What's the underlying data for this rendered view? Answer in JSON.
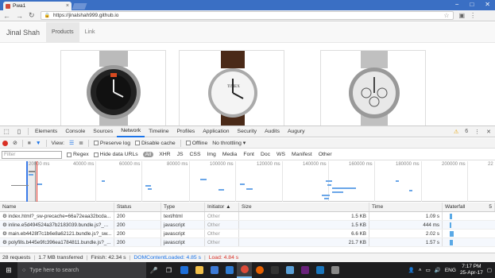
{
  "browser": {
    "tab_title": "Pwa1",
    "url": "https://jinalshah999.github.io",
    "win_buttons": [
      "−",
      "□",
      "✕"
    ]
  },
  "page": {
    "brand": "Jinal Shah",
    "nav": [
      "Products",
      "Link"
    ]
  },
  "devtools": {
    "tabs": [
      "Elements",
      "Console",
      "Sources",
      "Network",
      "Timeline",
      "Profiles",
      "Application",
      "Security",
      "Audits",
      "Augury"
    ],
    "active_tab": "Network",
    "warning_count": "6",
    "toolbar": {
      "view_label": "View:",
      "preserve_log": "Preserve log",
      "disable_cache": "Disable cache",
      "offline": "Offline",
      "throttle": "No throttling"
    },
    "filter": {
      "placeholder": "Filter",
      "regex": "Regex",
      "hide_data_urls": "Hide data URLs",
      "types": [
        "All",
        "XHR",
        "JS",
        "CSS",
        "Img",
        "Media",
        "Font",
        "Doc",
        "WS",
        "Manifest",
        "Other"
      ]
    },
    "overview_ticks": [
      "20000 ms",
      "40000 ms",
      "60000 ms",
      "80000 ms",
      "100000 ms",
      "120000 ms",
      "140000 ms",
      "160000 ms",
      "180000 ms",
      "200000 ms",
      "22"
    ],
    "columns": {
      "name": "Name",
      "status": "Status",
      "type": "Type",
      "initiator": "Initiator",
      "size": "Size",
      "time": "Time",
      "waterfall": "Waterfall",
      "waterfall_extra": "5"
    },
    "rows": [
      {
        "name": "index.html?_sw-precache=66a72eaa32bcda...",
        "status": "200",
        "type": "text/html",
        "initiator": "Other",
        "size": "1.5 KB",
        "time": "1.09 s",
        "wf": 0.55
      },
      {
        "name": "inline.e5d494524a37b2183039.bundle.js?_...",
        "status": "200",
        "type": "javascript",
        "initiator": "Other",
        "size": "1.5 KB",
        "time": "444 ms",
        "wf": 0.22
      },
      {
        "name": "main.eb4428f7c1b6e8a62121.bundle.js?_sw...",
        "status": "200",
        "type": "javascript",
        "initiator": "Other",
        "size": "6.6 KB",
        "time": "2.02 s",
        "wf": 1.0
      },
      {
        "name": "polyfills.b445e9fc396ea1784811.bundle.js?_...",
        "status": "200",
        "type": "javascript",
        "initiator": "Other",
        "size": "21.7 KB",
        "time": "1.57 s",
        "wf": 0.78
      }
    ],
    "status_bar": {
      "requests": "28 requests",
      "transferred": "1.7 MB transferred",
      "finish": "Finish: 42.34 s",
      "dcl": "DOMContentLoaded: 4.85 s",
      "load": "Load: 4.84 s"
    }
  },
  "taskbar": {
    "search_placeholder": "Type here to search",
    "time": "7:17 PM",
    "date": "25-Apr-17"
  }
}
